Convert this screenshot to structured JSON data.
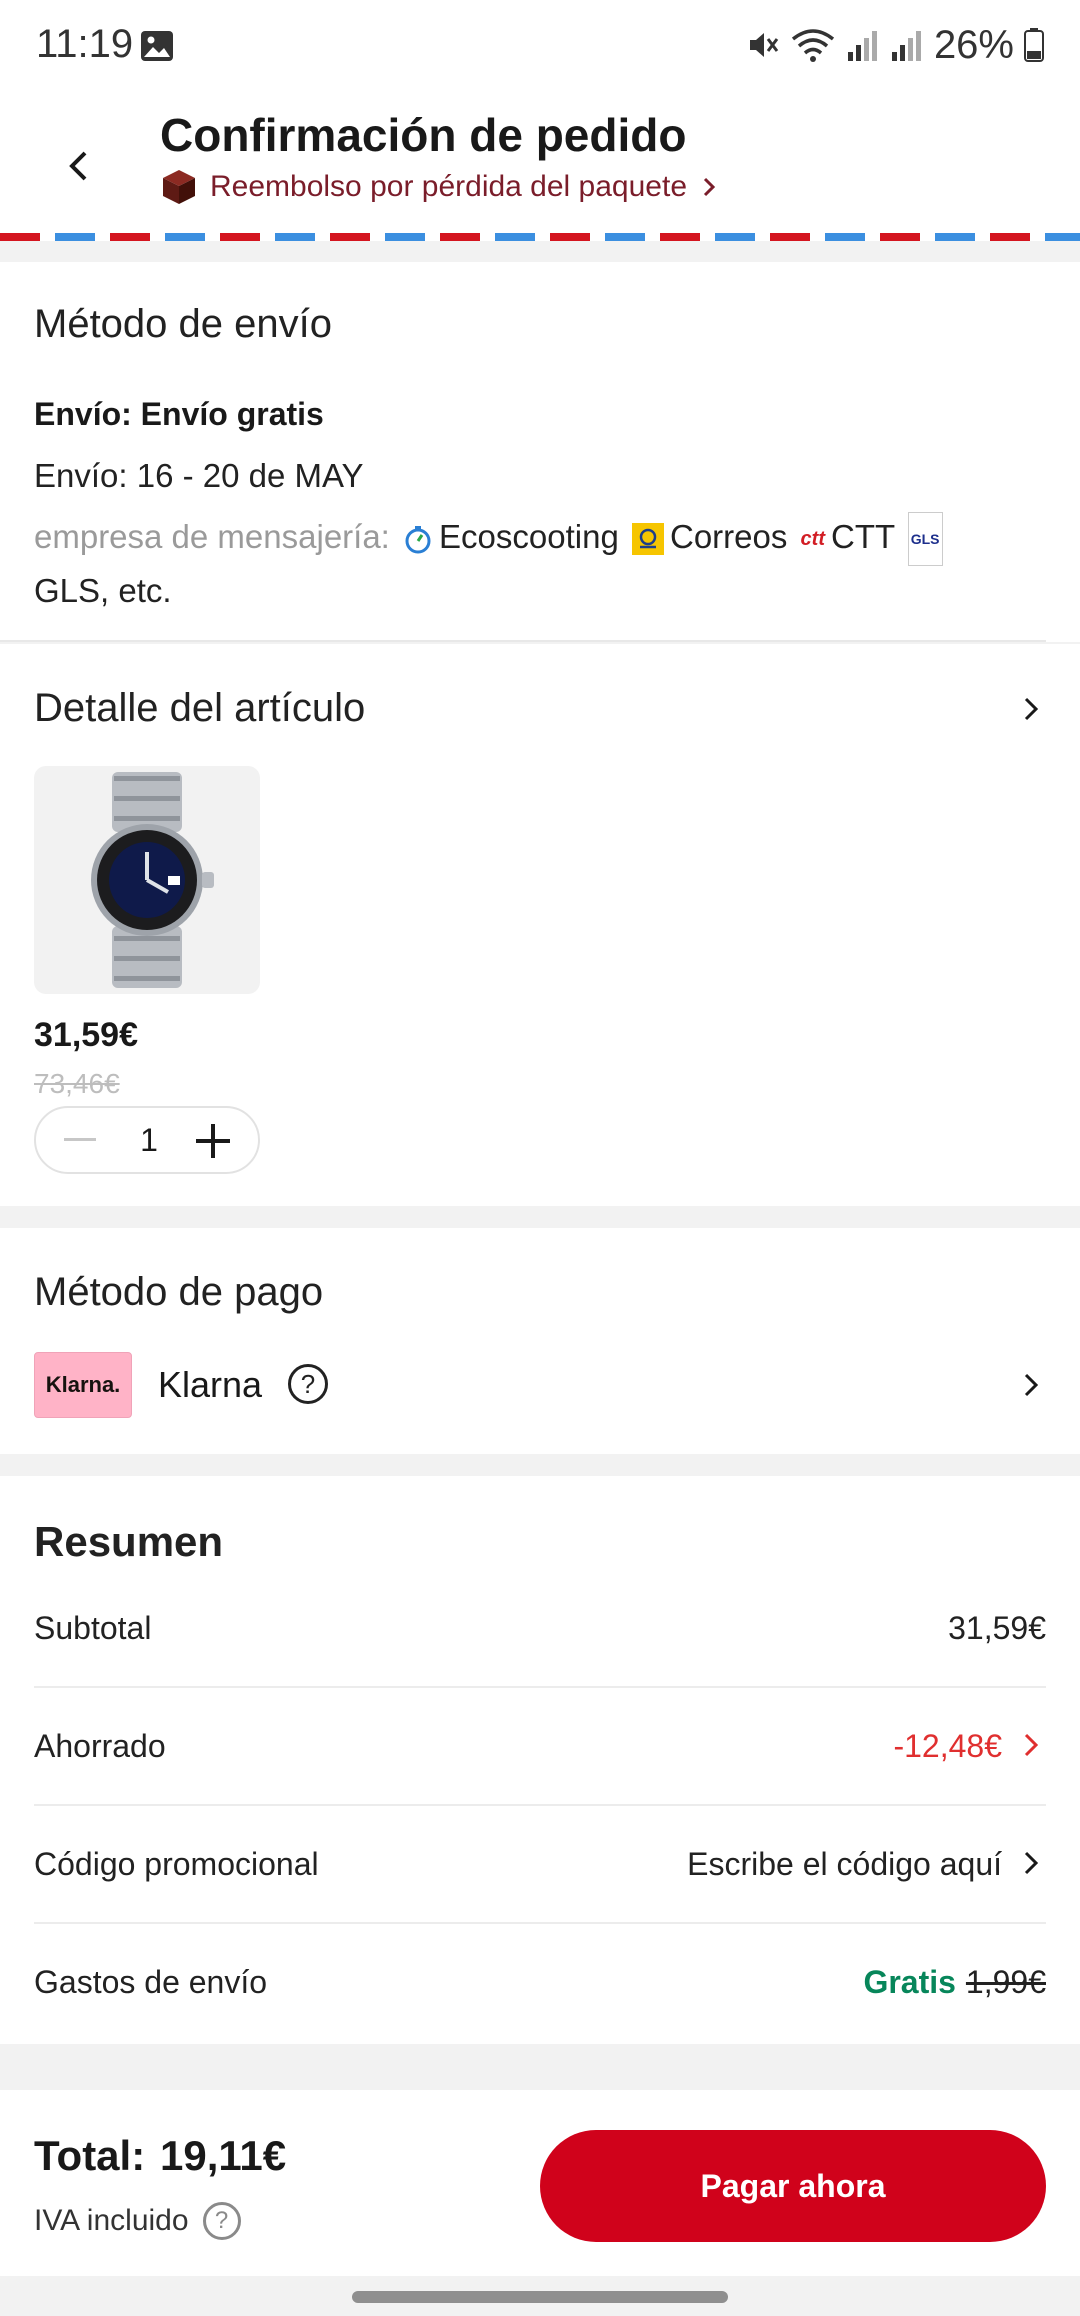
{
  "status_bar": {
    "time": "11:19",
    "battery": "26%"
  },
  "header": {
    "title": "Confirmación de pedido",
    "refund_link": "Reembolso por pérdida del paquete"
  },
  "shipping": {
    "title": "Método de envío",
    "type": "Envío: Envío gratis",
    "date": "Envío: 16 - 20 de MAY",
    "courier_label": "empresa de mensajería:",
    "couriers": [
      "Ecoscooting",
      "Correos",
      "CTT",
      "GLS, etc."
    ],
    "logo_texts": {
      "ctt": "ctt",
      "gls": "GLS"
    }
  },
  "item": {
    "title": "Detalle del artículo",
    "price": "31,59€",
    "old_price": "73,46€",
    "quantity": "1"
  },
  "payment": {
    "title": "Método de pago",
    "logo_text": "Klarna.",
    "name": "Klarna",
    "help": "?"
  },
  "summary": {
    "title": "Resumen",
    "subtotal_label": "Subtotal",
    "subtotal_value": "31,59€",
    "saved_label": "Ahorrado",
    "saved_value": "-12,48€",
    "promo_label": "Código promocional",
    "promo_value": "Escribe el código aquí",
    "shipping_label": "Gastos de envío",
    "shipping_free": "Gratis",
    "shipping_original": "1,99€"
  },
  "footer": {
    "total_label": "Total:",
    "total_value": "19,11€",
    "tax_note": "IVA incluido",
    "help": "?",
    "pay_button": "Pagar ahora"
  },
  "colors": {
    "primary_red": "#d0021b",
    "discount_red": "#e02f2f",
    "free_green": "#07865a",
    "klarna_pink": "#ffb3c7"
  }
}
